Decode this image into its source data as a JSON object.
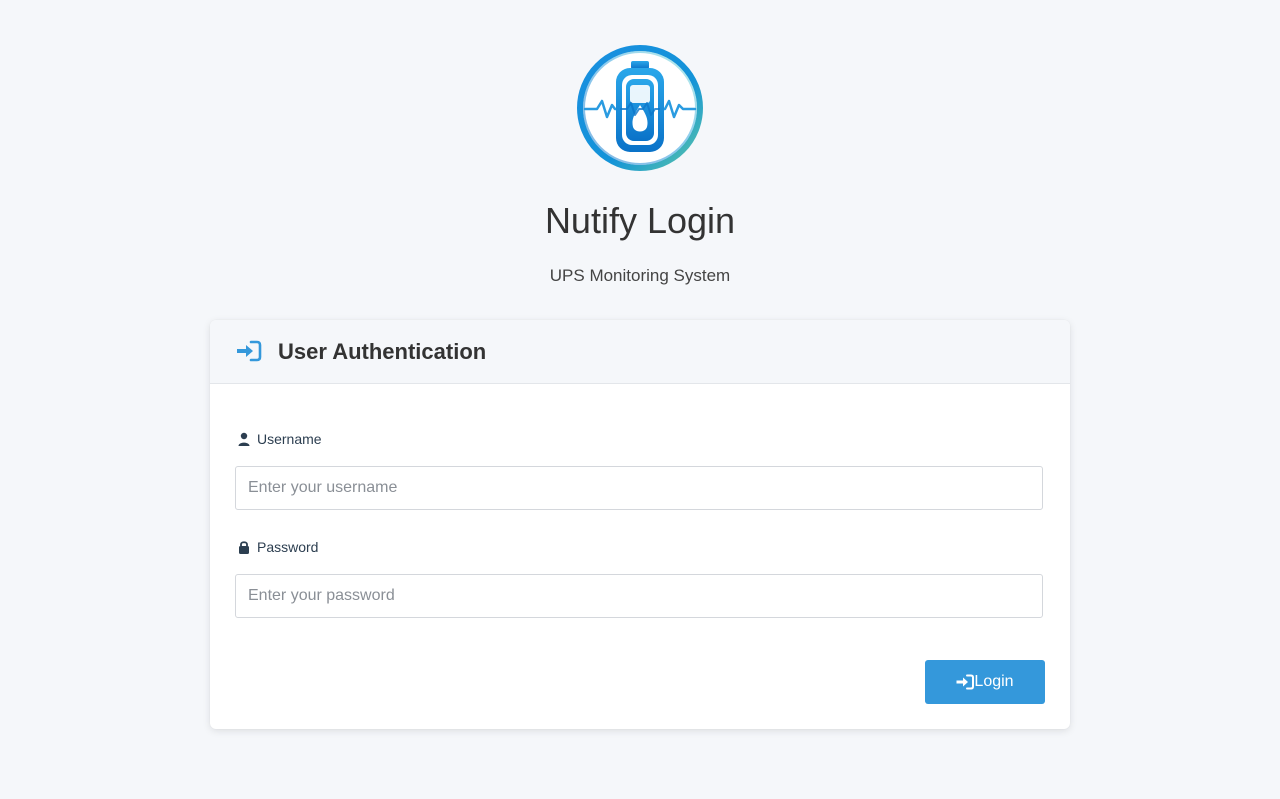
{
  "app": {
    "title": "Nutify Login",
    "subtitle": "UPS Monitoring System"
  },
  "card": {
    "header_title": "User Authentication",
    "header_icon": "sign-in-icon"
  },
  "form": {
    "username": {
      "label": "Username",
      "icon": "user-icon",
      "value": "",
      "placeholder": "Enter your username"
    },
    "password": {
      "label": "Password",
      "icon": "lock-icon",
      "value": "",
      "placeholder": "Enter your password"
    },
    "login_button": {
      "label": "Login",
      "icon": "sign-in-icon"
    }
  },
  "colors": {
    "accent": "#3498db",
    "background": "#f5f7fa",
    "logo_gradient_start": "#0b7fd6",
    "logo_gradient_end": "#6fd3c6"
  }
}
